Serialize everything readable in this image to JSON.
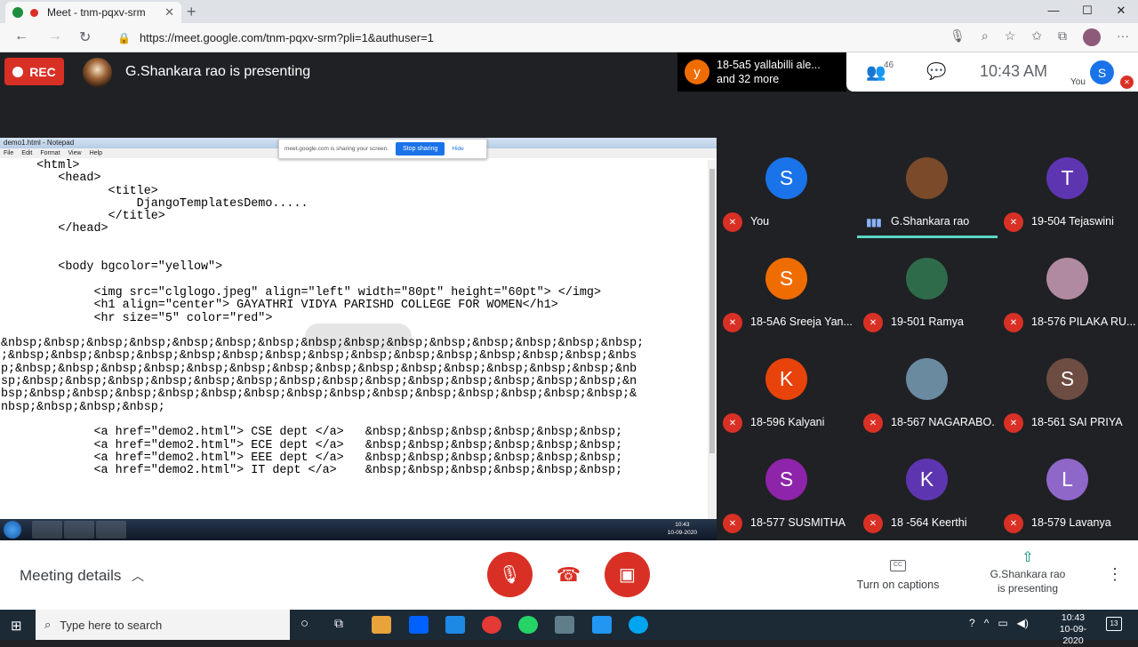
{
  "browser": {
    "tab_title": "Meet - tnm-pqxv-srm",
    "url": "https://meet.google.com/tnm-pqxv-srm?pli=1&authuser=1"
  },
  "meet_top": {
    "rec_label": "REC",
    "presenting_text": "G.Shankara rao is presenting",
    "join_initial": "y",
    "join_line1": "18-5a5 yallabilli ale...",
    "join_line2": "and 32 more",
    "people_count": "46",
    "time": "10:43  AM",
    "you_initial": "S",
    "you_label": "You"
  },
  "shared_screen": {
    "notepad_title": "demo1.html - Notepad",
    "menu": [
      "File",
      "Edit",
      "Format",
      "View",
      "Help"
    ],
    "share_note": "meet.google.com is sharing your screen.",
    "stop_sharing": "Stop sharing",
    "hide": "Hide",
    "code_lines": [
      "     <html>",
      "        <head>",
      "               <title>",
      "                   DjangoTemplatesDemo.....",
      "               </title>",
      "        </head>",
      "",
      "",
      "        <body bgcolor=\"yellow\">",
      "",
      "             <img src=\"clglogo.jpeg\" align=\"left\" width=\"80pt\" height=\"60pt\"> </img>",
      "             <h1 align=\"center\"> GAYATHRI VIDYA PARISHD COLLEGE FOR WOMEN</h1>",
      "             <hr size=\"5\" color=\"red\">",
      "",
      "&nbsp;&nbsp;&nbsp;&nbsp;&nbsp;&nbsp;&nbsp;&nbsp;&nbsp;&nbsp;&nbsp;&nbsp;&nbsp;&nbsp;&nbsp;",
      ";&nbsp;&nbsp;&nbsp;&nbsp;&nbsp;&nbsp;&nbsp;&nbsp;&nbsp;&nbsp;&nbsp;&nbsp;&nbsp;&nbsp;&nbs",
      "p;&nbsp;&nbsp;&nbsp;&nbsp;&nbsp;&nbsp;&nbsp;&nbsp;&nbsp;&nbsp;&nbsp;&nbsp;&nbsp;&nbsp;&nb",
      "sp;&nbsp;&nbsp;&nbsp;&nbsp;&nbsp;&nbsp;&nbsp;&nbsp;&nbsp;&nbsp;&nbsp;&nbsp;&nbsp;&nbsp;&n",
      "bsp;&nbsp;&nbsp;&nbsp;&nbsp;&nbsp;&nbsp;&nbsp;&nbsp;&nbsp;&nbsp;&nbsp;&nbsp;&nbsp;&nbsp;&",
      "nbsp;&nbsp;&nbsp;&nbsp;",
      "",
      "             <a href=\"demo2.html\"> CSE dept </a>   &nbsp;&nbsp;&nbsp;&nbsp;&nbsp;&nbsp;",
      "             <a href=\"demo2.html\"> ECE dept </a>   &nbsp;&nbsp;&nbsp;&nbsp;&nbsp;&nbsp;",
      "             <a href=\"demo2.html\"> EEE dept </a>   &nbsp;&nbsp;&nbsp;&nbsp;&nbsp;&nbsp;",
      "             <a href=\"demo2.html\"> IT dept </a>    &nbsp;&nbsp;&nbsp;&nbsp;&nbsp;&nbsp;"
    ],
    "win7_time": "10:43",
    "win7_date": "10-09-2020"
  },
  "participants": [
    {
      "initial": "S",
      "name": "You",
      "color": "#1a73e8",
      "speaking": false
    },
    {
      "initial": "",
      "name": "G.Shankara rao",
      "color": "#7a4a2a",
      "speaking": true
    },
    {
      "initial": "T",
      "name": "19-504 Tejaswini",
      "color": "#5e35b1",
      "speaking": false
    },
    {
      "initial": "S",
      "name": "18-5A6 Sreeja Yan...",
      "color": "#ef6c00",
      "speaking": false
    },
    {
      "initial": "",
      "name": "19-501 Ramya",
      "color": "#2e6b4a",
      "speaking": false
    },
    {
      "initial": "",
      "name": "18-576 PILAKA RU...",
      "color": "#b08aa0",
      "speaking": false
    },
    {
      "initial": "K",
      "name": "18-596 Kalyani",
      "color": "#e8430a",
      "speaking": false
    },
    {
      "initial": "",
      "name": "18-567 NAGARABO...",
      "color": "#6a8aa0",
      "speaking": false
    },
    {
      "initial": "S",
      "name": "18-561 SAI PRIYA",
      "color": "#6d4c41",
      "speaking": false
    },
    {
      "initial": "S",
      "name": "18-577 SUSMITHA",
      "color": "#8e24aa",
      "speaking": false
    },
    {
      "initial": "K",
      "name": "18 -564 Keerthi",
      "color": "#5e35b1",
      "speaking": false
    },
    {
      "initial": "L",
      "name": "18-579 Lavanya",
      "color": "#8e67c9",
      "speaking": false
    }
  ],
  "bottom": {
    "meeting_details": "Meeting details",
    "captions": "Turn on captions",
    "presenting_line1": "G.Shankara rao",
    "presenting_line2": "is presenting"
  },
  "windows": {
    "search_placeholder": "Type here to search",
    "time": "10:43",
    "date": "10-09-2020",
    "notifications": "13"
  }
}
